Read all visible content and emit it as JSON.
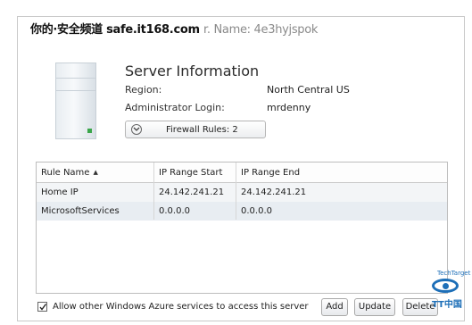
{
  "watermark": {
    "prefix": "你的·安全频道",
    "site": "safe.it168.com",
    "faded": "r. Name: 4e3hyjspok"
  },
  "server": {
    "title": "Server Information",
    "region_label": "Region:",
    "region_value": "North Central US",
    "admin_label": "Administrator Login:",
    "admin_value": "mrdenny",
    "firewall_button": "Firewall Rules: 2"
  },
  "rules_table": {
    "columns": [
      "Rule Name",
      "IP Range Start",
      "IP Range End"
    ],
    "sort_icon": "▲",
    "rows": [
      [
        "Home IP",
        "24.142.241.21",
        "24.142.241.21"
      ],
      [
        "MicrosoftServices",
        "0.0.0.0",
        "0.0.0.0"
      ]
    ]
  },
  "footer": {
    "allow_azure_label": "Allow other Windows Azure services to access this server",
    "allow_azure_checked": true,
    "add_label": "Add",
    "update_label": "Update",
    "delete_label": "Delete"
  },
  "logo": {
    "brand": "TechTarget",
    "mark": "TT中国"
  },
  "colors": {
    "accent_blue": "#1d6fb8",
    "row_alt": "#e8edf2",
    "led_green": "#3aa64a"
  }
}
